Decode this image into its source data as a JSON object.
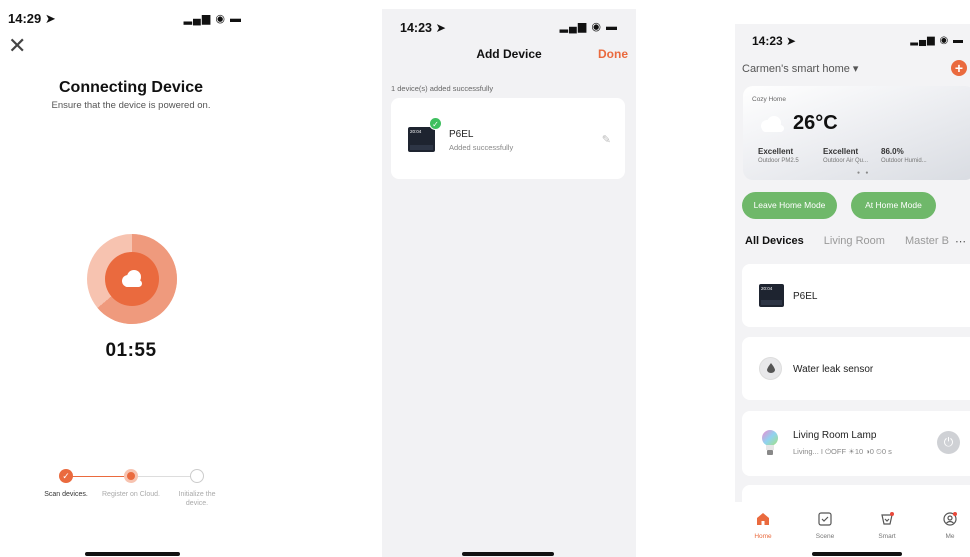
{
  "connecting": {
    "time": "14:29",
    "close": "✕",
    "title": "Connecting Device",
    "subtitle": "Ensure that the device is powered on.",
    "timer": "01:55",
    "steps": [
      {
        "label": "Scan devices.",
        "state": "done"
      },
      {
        "label": "Register on Cloud.",
        "state": "active"
      },
      {
        "label": "Initialize the device.",
        "state": "pending"
      }
    ]
  },
  "add_device": {
    "time": "14:23",
    "title": "Add Device",
    "done_label": "Done",
    "added_message": "1 device(s) added successfully",
    "device": {
      "name": "P6EL",
      "status": "Added successfully",
      "thumb_text": "20:04"
    }
  },
  "home": {
    "time": "14:23",
    "home_name": "Carmen's smart home",
    "weather": {
      "label": "Cozy Home",
      "temperature": "26°C",
      "metrics": [
        {
          "value": "Excellent",
          "label": "Outdoor PM2.5"
        },
        {
          "value": "Excellent",
          "label": "Outdoor Air Qu..."
        },
        {
          "value": "86.0%",
          "label": "Outdoor Humid..."
        }
      ]
    },
    "modes": [
      "Leave Home Mode",
      "At Home Mode"
    ],
    "tabs": [
      "All Devices",
      "Living Room",
      "Master B"
    ],
    "devices": [
      {
        "name": "P6EL"
      },
      {
        "name": "Water leak sensor"
      },
      {
        "name": "Living Room Lamp",
        "info": "Living...  I  ⏻OFF  ☀10  ◑0  ⏲0 s"
      }
    ],
    "tabbar": [
      "Home",
      "Scene",
      "Smart",
      "Me"
    ],
    "colors": {
      "accent": "#ea6a3e",
      "mode_button": "#6fb86a",
      "success": "#3fbf5f"
    }
  }
}
